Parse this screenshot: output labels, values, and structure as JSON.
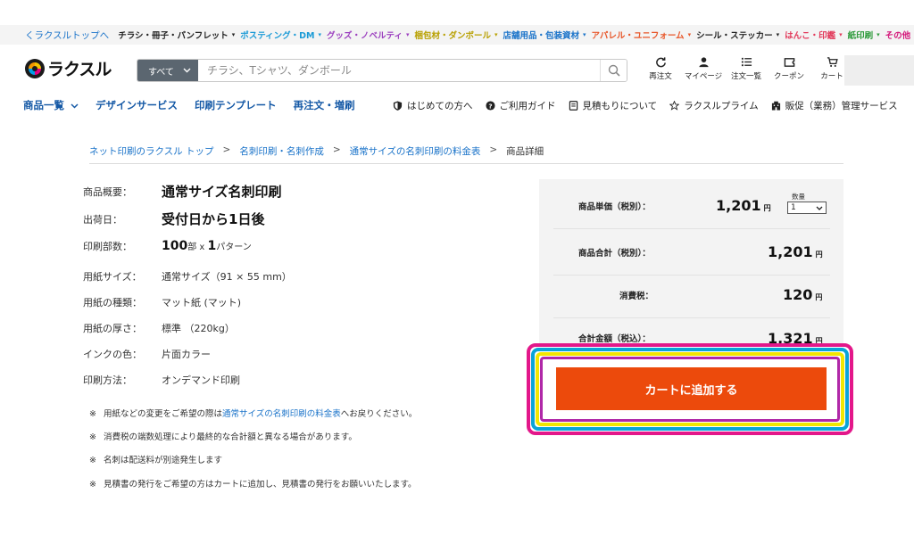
{
  "topbar": {
    "back_label": "くラクスルトップへ",
    "categories": [
      {
        "label": "チラシ・冊子・パンフレット",
        "color": "#222222"
      },
      {
        "label": "ポスティング・DM",
        "color": "#1a9ad6"
      },
      {
        "label": "グッズ・ノベルティ",
        "color": "#9b3fbf"
      },
      {
        "label": "梱包材・ダンボール",
        "color": "#b8a000"
      },
      {
        "label": "店舗用品・包装資材",
        "color": "#1a73c9"
      },
      {
        "label": "アパレル・ユニフォーム",
        "color": "#e8572a"
      },
      {
        "label": "シール・ステッカー",
        "color": "#222222"
      },
      {
        "label": "はんこ・印鑑",
        "color": "#e23a5b"
      },
      {
        "label": "紙印刷",
        "color": "#2f9b3c"
      },
      {
        "label": "その他",
        "color": "#d4177a"
      }
    ]
  },
  "header": {
    "logo_text": "ラクスル",
    "search_category": "すべて",
    "search_placeholder": "チラシ、Tシャツ、ダンボール",
    "icons": [
      {
        "name": "reorder-icon",
        "label": "再注文"
      },
      {
        "name": "mypage-icon",
        "label": "マイページ"
      },
      {
        "name": "order-list-icon",
        "label": "注文一覧"
      },
      {
        "name": "coupon-icon",
        "label": "クーポン"
      },
      {
        "name": "cart-icon",
        "label": "カート"
      }
    ]
  },
  "nav": {
    "main": [
      "商品一覧",
      "デザインサービス",
      "印刷テンプレート",
      "再注文・増刷"
    ],
    "sub": [
      {
        "icon": "shield-icon",
        "label": "はじめての方へ"
      },
      {
        "icon": "help-icon",
        "label": "ご利用ガイド"
      },
      {
        "icon": "document-icon",
        "label": "見積もりについて"
      },
      {
        "icon": "star-icon",
        "label": "ラクスルプライム"
      },
      {
        "icon": "building-icon",
        "label": "販促（業務）管理サービス"
      }
    ]
  },
  "breadcrumb": {
    "items": [
      "ネット印刷のラクスル トップ",
      "名刺印刷・名刺作成",
      "通常サイズの名刺印刷の料金表"
    ],
    "separator": ">",
    "current": "商品詳細"
  },
  "product": {
    "overview_label": "商品概要：",
    "overview_value": "通常サイズ名刺印刷",
    "ship_label": "出荷日：",
    "ship_value": "受付日から1日後",
    "copies_label": "印刷部数：",
    "copies_num": "100",
    "copies_unit": "部 x ",
    "pattern_num": "1",
    "pattern_unit": "パターン",
    "size_label": "用紙サイズ：",
    "size_value": "通常サイズ（91 × 55 mm）",
    "paper_type_label": "用紙の種類：",
    "paper_type_value": "マット紙 (マット)",
    "thickness_label": "用紙の厚さ：",
    "thickness_value": "標準 （220kg）",
    "ink_label": "インクの色：",
    "ink_value": "片面カラー",
    "method_label": "印刷方法：",
    "method_value": "オンデマンド印刷"
  },
  "notes": {
    "mark": "※",
    "note1_pre": "用紙などの変更をご希望の際は",
    "note1_link": "通常サイズの名刺印刷の料金表",
    "note1_post": "へお戻りください。",
    "note2": "消費税の端数処理により最終的な合計額と異なる場合があります。",
    "note3": "名刺は配送料が別途発生します",
    "note4": "見積書の発行をご希望の方はカートに追加し、見積書の発行をお願いいたします。"
  },
  "price": {
    "unit_label": "商品単価（税別）：",
    "unit_value": "1,201",
    "subtotal_label": "商品合計（税別）：",
    "subtotal_value": "1,201",
    "tax_label": "消費税：",
    "tax_value": "120",
    "total_label": "合計金額（税込）：",
    "total_value": "1,321",
    "yen": "円",
    "qty_label": "数量",
    "qty_value": "1"
  },
  "cta": {
    "add_to_cart": "カートに追加する"
  },
  "colors": {
    "accent_orange": "#ec4a0c",
    "link_blue": "#1a73c9",
    "nav_blue": "#1559a6",
    "highlight_pink": "#e3178a"
  }
}
